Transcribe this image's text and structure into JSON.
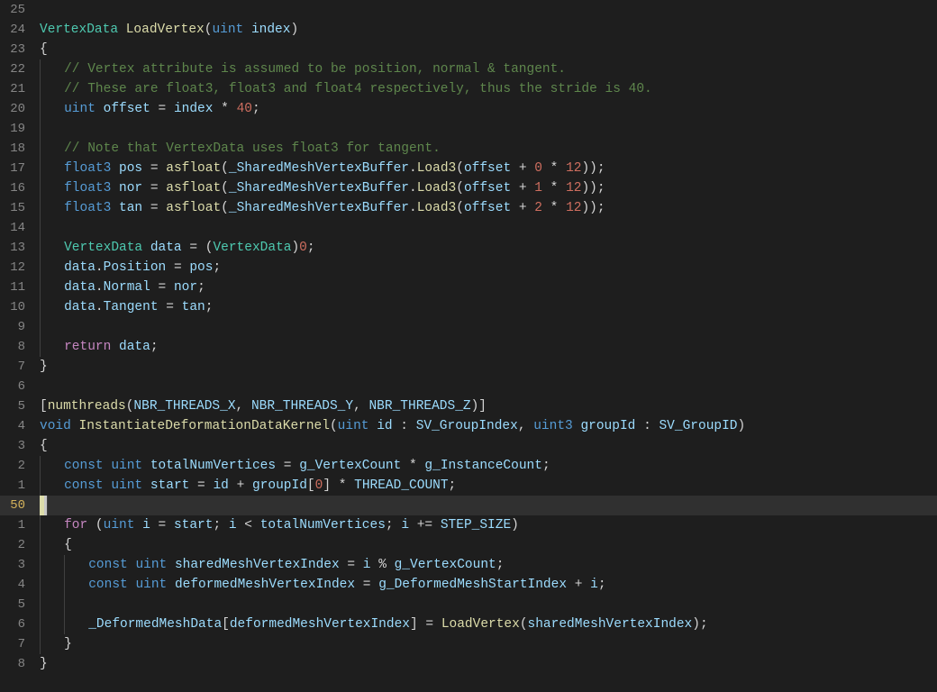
{
  "editor": {
    "current_line_index": 25,
    "language": "hlsl",
    "lines": [
      {
        "num": "25",
        "tokens": []
      },
      {
        "num": "24",
        "tokens": [
          {
            "c": "tk-class",
            "t": "VertexData"
          },
          {
            "c": "tk-def",
            "t": " "
          },
          {
            "c": "tk-func",
            "t": "LoadVertex"
          },
          {
            "c": "tk-punc",
            "t": "("
          },
          {
            "c": "tk-type",
            "t": "uint"
          },
          {
            "c": "tk-def",
            "t": " "
          },
          {
            "c": "tk-var",
            "t": "index"
          },
          {
            "c": "tk-punc",
            "t": ")"
          }
        ]
      },
      {
        "num": "23",
        "tokens": [
          {
            "c": "tk-brace",
            "t": "{"
          }
        ]
      },
      {
        "num": "22",
        "indent": 1,
        "tokens": [
          {
            "c": "tk-comment",
            "t": "// Vertex attribute is assumed to be position, normal & tangent."
          }
        ]
      },
      {
        "num": "21",
        "indent": 1,
        "tokens": [
          {
            "c": "tk-comment",
            "t": "// These are float3, float3 and float4 respectively, thus the stride is 40."
          }
        ]
      },
      {
        "num": "20",
        "indent": 1,
        "tokens": [
          {
            "c": "tk-type",
            "t": "uint"
          },
          {
            "c": "tk-def",
            "t": " "
          },
          {
            "c": "tk-var",
            "t": "offset"
          },
          {
            "c": "tk-def",
            "t": " = "
          },
          {
            "c": "tk-var",
            "t": "index"
          },
          {
            "c": "tk-def",
            "t": " * "
          },
          {
            "c": "tk-numlit",
            "t": "40"
          },
          {
            "c": "tk-punc",
            "t": ";"
          }
        ]
      },
      {
        "num": "19",
        "indent": 1,
        "tokens": []
      },
      {
        "num": "18",
        "indent": 1,
        "tokens": [
          {
            "c": "tk-comment",
            "t": "// Note that VertexData uses float3 for tangent."
          }
        ]
      },
      {
        "num": "17",
        "indent": 1,
        "tokens": [
          {
            "c": "tk-type",
            "t": "float3"
          },
          {
            "c": "tk-def",
            "t": " "
          },
          {
            "c": "tk-var",
            "t": "pos"
          },
          {
            "c": "tk-def",
            "t": " = "
          },
          {
            "c": "tk-func",
            "t": "asfloat"
          },
          {
            "c": "tk-punc",
            "t": "("
          },
          {
            "c": "tk-var",
            "t": "_SharedMeshVertexBuffer"
          },
          {
            "c": "tk-punc",
            "t": "."
          },
          {
            "c": "tk-func",
            "t": "Load3"
          },
          {
            "c": "tk-punc",
            "t": "("
          },
          {
            "c": "tk-var",
            "t": "offset"
          },
          {
            "c": "tk-def",
            "t": " + "
          },
          {
            "c": "tk-numlit",
            "t": "0"
          },
          {
            "c": "tk-def",
            "t": " * "
          },
          {
            "c": "tk-numlit",
            "t": "12"
          },
          {
            "c": "tk-punc",
            "t": "));"
          }
        ]
      },
      {
        "num": "16",
        "indent": 1,
        "tokens": [
          {
            "c": "tk-type",
            "t": "float3"
          },
          {
            "c": "tk-def",
            "t": " "
          },
          {
            "c": "tk-var",
            "t": "nor"
          },
          {
            "c": "tk-def",
            "t": " = "
          },
          {
            "c": "tk-func",
            "t": "asfloat"
          },
          {
            "c": "tk-punc",
            "t": "("
          },
          {
            "c": "tk-var",
            "t": "_SharedMeshVertexBuffer"
          },
          {
            "c": "tk-punc",
            "t": "."
          },
          {
            "c": "tk-func",
            "t": "Load3"
          },
          {
            "c": "tk-punc",
            "t": "("
          },
          {
            "c": "tk-var",
            "t": "offset"
          },
          {
            "c": "tk-def",
            "t": " + "
          },
          {
            "c": "tk-numlit",
            "t": "1"
          },
          {
            "c": "tk-def",
            "t": " * "
          },
          {
            "c": "tk-numlit",
            "t": "12"
          },
          {
            "c": "tk-punc",
            "t": "));"
          }
        ]
      },
      {
        "num": "15",
        "indent": 1,
        "tokens": [
          {
            "c": "tk-type",
            "t": "float3"
          },
          {
            "c": "tk-def",
            "t": " "
          },
          {
            "c": "tk-var",
            "t": "tan"
          },
          {
            "c": "tk-def",
            "t": " = "
          },
          {
            "c": "tk-func",
            "t": "asfloat"
          },
          {
            "c": "tk-punc",
            "t": "("
          },
          {
            "c": "tk-var",
            "t": "_SharedMeshVertexBuffer"
          },
          {
            "c": "tk-punc",
            "t": "."
          },
          {
            "c": "tk-func",
            "t": "Load3"
          },
          {
            "c": "tk-punc",
            "t": "("
          },
          {
            "c": "tk-var",
            "t": "offset"
          },
          {
            "c": "tk-def",
            "t": " + "
          },
          {
            "c": "tk-numlit",
            "t": "2"
          },
          {
            "c": "tk-def",
            "t": " * "
          },
          {
            "c": "tk-numlit",
            "t": "12"
          },
          {
            "c": "tk-punc",
            "t": "));"
          }
        ]
      },
      {
        "num": "14",
        "indent": 1,
        "tokens": []
      },
      {
        "num": "13",
        "indent": 1,
        "tokens": [
          {
            "c": "tk-class",
            "t": "VertexData"
          },
          {
            "c": "tk-def",
            "t": " "
          },
          {
            "c": "tk-var",
            "t": "data"
          },
          {
            "c": "tk-def",
            "t": " = ("
          },
          {
            "c": "tk-class",
            "t": "VertexData"
          },
          {
            "c": "tk-def",
            "t": ")"
          },
          {
            "c": "tk-numlit",
            "t": "0"
          },
          {
            "c": "tk-punc",
            "t": ";"
          }
        ]
      },
      {
        "num": "12",
        "indent": 1,
        "tokens": [
          {
            "c": "tk-var",
            "t": "data"
          },
          {
            "c": "tk-punc",
            "t": "."
          },
          {
            "c": "tk-var",
            "t": "Position"
          },
          {
            "c": "tk-def",
            "t": " = "
          },
          {
            "c": "tk-var",
            "t": "pos"
          },
          {
            "c": "tk-punc",
            "t": ";"
          }
        ]
      },
      {
        "num": "11",
        "indent": 1,
        "tokens": [
          {
            "c": "tk-var",
            "t": "data"
          },
          {
            "c": "tk-punc",
            "t": "."
          },
          {
            "c": "tk-var",
            "t": "Normal"
          },
          {
            "c": "tk-def",
            "t": " = "
          },
          {
            "c": "tk-var",
            "t": "nor"
          },
          {
            "c": "tk-punc",
            "t": ";"
          }
        ]
      },
      {
        "num": "10",
        "indent": 1,
        "tokens": [
          {
            "c": "tk-var",
            "t": "data"
          },
          {
            "c": "tk-punc",
            "t": "."
          },
          {
            "c": "tk-var",
            "t": "Tangent"
          },
          {
            "c": "tk-def",
            "t": " = "
          },
          {
            "c": "tk-var",
            "t": "tan"
          },
          {
            "c": "tk-punc",
            "t": ";"
          }
        ]
      },
      {
        "num": "9",
        "indent": 1,
        "tokens": []
      },
      {
        "num": "8",
        "indent": 1,
        "tokens": [
          {
            "c": "tk-flow",
            "t": "return"
          },
          {
            "c": "tk-def",
            "t": " "
          },
          {
            "c": "tk-var",
            "t": "data"
          },
          {
            "c": "tk-punc",
            "t": ";"
          }
        ]
      },
      {
        "num": "7",
        "tokens": [
          {
            "c": "tk-brace",
            "t": "}"
          }
        ]
      },
      {
        "num": "6",
        "tokens": []
      },
      {
        "num": "5",
        "tokens": [
          {
            "c": "tk-punc",
            "t": "["
          },
          {
            "c": "tk-func",
            "t": "numthreads"
          },
          {
            "c": "tk-punc",
            "t": "("
          },
          {
            "c": "tk-var",
            "t": "NBR_THREADS_X"
          },
          {
            "c": "tk-punc",
            "t": ", "
          },
          {
            "c": "tk-var",
            "t": "NBR_THREADS_Y"
          },
          {
            "c": "tk-punc",
            "t": ", "
          },
          {
            "c": "tk-var",
            "t": "NBR_THREADS_Z"
          },
          {
            "c": "tk-punc",
            "t": ")]"
          }
        ]
      },
      {
        "num": "4",
        "tokens": [
          {
            "c": "tk-type",
            "t": "void"
          },
          {
            "c": "tk-def",
            "t": " "
          },
          {
            "c": "tk-func",
            "t": "InstantiateDeformationDataKernel"
          },
          {
            "c": "tk-punc",
            "t": "("
          },
          {
            "c": "tk-type",
            "t": "uint"
          },
          {
            "c": "tk-def",
            "t": " "
          },
          {
            "c": "tk-var",
            "t": "id"
          },
          {
            "c": "tk-def",
            "t": " : "
          },
          {
            "c": "tk-var",
            "t": "SV_GroupIndex"
          },
          {
            "c": "tk-punc",
            "t": ", "
          },
          {
            "c": "tk-type",
            "t": "uint3"
          },
          {
            "c": "tk-def",
            "t": " "
          },
          {
            "c": "tk-var",
            "t": "groupId"
          },
          {
            "c": "tk-def",
            "t": " : "
          },
          {
            "c": "tk-var",
            "t": "SV_GroupID"
          },
          {
            "c": "tk-punc",
            "t": ")"
          }
        ]
      },
      {
        "num": "3",
        "tokens": [
          {
            "c": "tk-brace",
            "t": "{"
          }
        ]
      },
      {
        "num": "2",
        "indent": 1,
        "tokens": [
          {
            "c": "tk-keyword",
            "t": "const"
          },
          {
            "c": "tk-def",
            "t": " "
          },
          {
            "c": "tk-type",
            "t": "uint"
          },
          {
            "c": "tk-def",
            "t": " "
          },
          {
            "c": "tk-var",
            "t": "totalNumVertices"
          },
          {
            "c": "tk-def",
            "t": " = "
          },
          {
            "c": "tk-var",
            "t": "g_VertexCount"
          },
          {
            "c": "tk-def",
            "t": " * "
          },
          {
            "c": "tk-var",
            "t": "g_InstanceCount"
          },
          {
            "c": "tk-punc",
            "t": ";"
          }
        ]
      },
      {
        "num": "1",
        "indent": 1,
        "tokens": [
          {
            "c": "tk-keyword",
            "t": "const"
          },
          {
            "c": "tk-def",
            "t": " "
          },
          {
            "c": "tk-type",
            "t": "uint"
          },
          {
            "c": "tk-def",
            "t": " "
          },
          {
            "c": "tk-var",
            "t": "start"
          },
          {
            "c": "tk-def",
            "t": " = "
          },
          {
            "c": "tk-var",
            "t": "id"
          },
          {
            "c": "tk-def",
            "t": " + "
          },
          {
            "c": "tk-var",
            "t": "groupId"
          },
          {
            "c": "tk-punc",
            "t": "["
          },
          {
            "c": "tk-numlit",
            "t": "0"
          },
          {
            "c": "tk-punc",
            "t": "]"
          },
          {
            "c": "tk-def",
            "t": " * "
          },
          {
            "c": "tk-var",
            "t": "THREAD_COUNT"
          },
          {
            "c": "tk-punc",
            "t": ";"
          }
        ]
      },
      {
        "num": "50",
        "current": true,
        "cursor": true,
        "indent": 1,
        "tokens": []
      },
      {
        "num": "1",
        "indent": 1,
        "tokens": [
          {
            "c": "tk-flow",
            "t": "for"
          },
          {
            "c": "tk-def",
            "t": " ("
          },
          {
            "c": "tk-type",
            "t": "uint"
          },
          {
            "c": "tk-def",
            "t": " "
          },
          {
            "c": "tk-var",
            "t": "i"
          },
          {
            "c": "tk-def",
            "t": " = "
          },
          {
            "c": "tk-var",
            "t": "start"
          },
          {
            "c": "tk-punc",
            "t": "; "
          },
          {
            "c": "tk-var",
            "t": "i"
          },
          {
            "c": "tk-def",
            "t": " < "
          },
          {
            "c": "tk-var",
            "t": "totalNumVertices"
          },
          {
            "c": "tk-punc",
            "t": "; "
          },
          {
            "c": "tk-var",
            "t": "i"
          },
          {
            "c": "tk-def",
            "t": " += "
          },
          {
            "c": "tk-var",
            "t": "STEP_SIZE"
          },
          {
            "c": "tk-punc",
            "t": ")"
          }
        ]
      },
      {
        "num": "2",
        "indent": 1,
        "tokens": [
          {
            "c": "tk-brace",
            "t": "{"
          }
        ]
      },
      {
        "num": "3",
        "indent": 2,
        "tokens": [
          {
            "c": "tk-keyword",
            "t": "const"
          },
          {
            "c": "tk-def",
            "t": " "
          },
          {
            "c": "tk-type",
            "t": "uint"
          },
          {
            "c": "tk-def",
            "t": " "
          },
          {
            "c": "tk-var",
            "t": "sharedMeshVertexIndex"
          },
          {
            "c": "tk-def",
            "t": " = "
          },
          {
            "c": "tk-var",
            "t": "i"
          },
          {
            "c": "tk-def",
            "t": " % "
          },
          {
            "c": "tk-var",
            "t": "g_VertexCount"
          },
          {
            "c": "tk-punc",
            "t": ";"
          }
        ]
      },
      {
        "num": "4",
        "indent": 2,
        "tokens": [
          {
            "c": "tk-keyword",
            "t": "const"
          },
          {
            "c": "tk-def",
            "t": " "
          },
          {
            "c": "tk-type",
            "t": "uint"
          },
          {
            "c": "tk-def",
            "t": " "
          },
          {
            "c": "tk-var",
            "t": "deformedMeshVertexIndex"
          },
          {
            "c": "tk-def",
            "t": " = "
          },
          {
            "c": "tk-var",
            "t": "g_DeformedMeshStartIndex"
          },
          {
            "c": "tk-def",
            "t": " + "
          },
          {
            "c": "tk-var",
            "t": "i"
          },
          {
            "c": "tk-punc",
            "t": ";"
          }
        ]
      },
      {
        "num": "5",
        "indent": 2,
        "tokens": []
      },
      {
        "num": "6",
        "indent": 2,
        "tokens": [
          {
            "c": "tk-var",
            "t": "_DeformedMeshData"
          },
          {
            "c": "tk-punc",
            "t": "["
          },
          {
            "c": "tk-var",
            "t": "deformedMeshVertexIndex"
          },
          {
            "c": "tk-punc",
            "t": "]"
          },
          {
            "c": "tk-def",
            "t": " = "
          },
          {
            "c": "tk-func",
            "t": "LoadVertex"
          },
          {
            "c": "tk-punc",
            "t": "("
          },
          {
            "c": "tk-var",
            "t": "sharedMeshVertexIndex"
          },
          {
            "c": "tk-punc",
            "t": ");"
          }
        ]
      },
      {
        "num": "7",
        "indent": 1,
        "tokens": [
          {
            "c": "tk-brace",
            "t": "}"
          }
        ]
      },
      {
        "num": "8",
        "tokens": [
          {
            "c": "tk-brace",
            "t": "}"
          }
        ]
      }
    ]
  }
}
